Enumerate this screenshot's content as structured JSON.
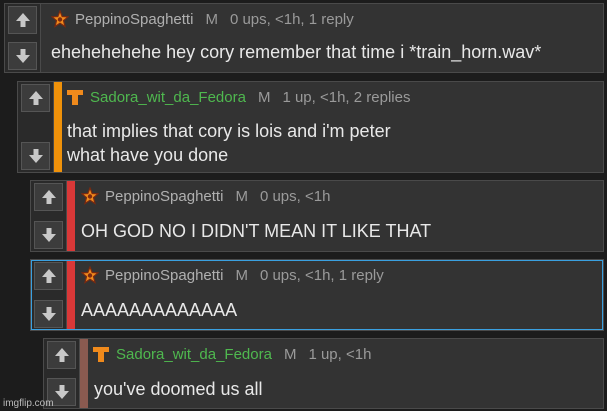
{
  "theme": {
    "red_user_color": "#a8a8a8",
    "green_user_color": "#4fb84f",
    "accent_orange": "#f08a1c",
    "stripe_orange": "#f0920a",
    "stripe_red": "#d93838",
    "stripe_blue": "#3aa0e0",
    "stripe_brown": "#8a5a50"
  },
  "comments": [
    {
      "username": "PeppinoSpaghetti",
      "gender": "M",
      "meta": "0 ups, <1h, 1 reply",
      "text_lines": [
        "ehehehehehe hey cory remember that time i *train_horn.wav*"
      ],
      "icon": "star-icon"
    },
    {
      "username": "Sadora_wit_da_Fedora",
      "gender": "M",
      "meta": "1 up, <1h, 2 replies",
      "text_lines": [
        "that implies that cory is lois and i'm peter",
        "what have you done"
      ],
      "icon": "t-block-icon"
    },
    {
      "username": "PeppinoSpaghetti",
      "gender": "M",
      "meta": "0 ups, <1h",
      "text_lines": [
        "OH GOD NO I DIDN'T MEAN IT LIKE THAT"
      ],
      "icon": "star-icon"
    },
    {
      "username": "PeppinoSpaghetti",
      "gender": "M",
      "meta": "0 ups, <1h, 1 reply",
      "text_lines": [
        "AAAAAAAAAAAAA"
      ],
      "icon": "star-icon"
    },
    {
      "username": "Sadora_wit_da_Fedora",
      "gender": "M",
      "meta": "1 up, <1h",
      "text_lines": [
        "you've doomed us all"
      ],
      "icon": "t-block-icon"
    }
  ],
  "watermark": "imgflip.com"
}
